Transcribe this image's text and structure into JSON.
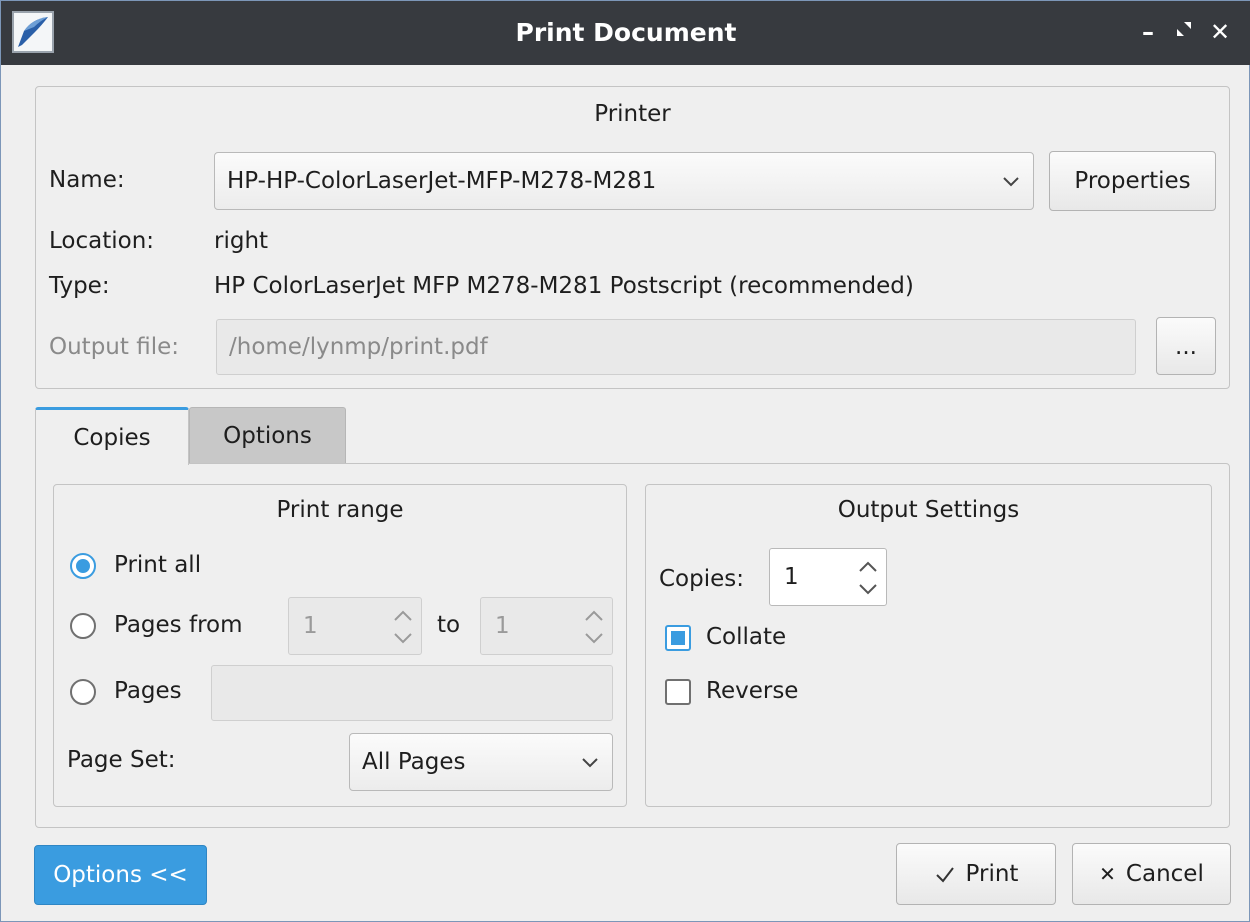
{
  "window": {
    "title": "Print Document"
  },
  "printer_group": {
    "title": "Printer",
    "name_label": "Name:",
    "printer_name": "HP-HP-ColorLaserJet-MFP-M278-M281",
    "properties_label": "Properties",
    "location_label": "Location:",
    "location_value": "right",
    "type_label": "Type:",
    "type_value": "HP ColorLaserJet MFP M278-M281 Postscript (recommended)",
    "output_file_label": "Output file:",
    "output_file_value": "/home/lynmp/print.pdf",
    "browse_label": "..."
  },
  "tabs": [
    {
      "label": "Copies",
      "active": true
    },
    {
      "label": "Options",
      "active": false
    }
  ],
  "print_range": {
    "title": "Print range",
    "print_all_label": "Print all",
    "pages_from_label": "Pages from",
    "from_value": "1",
    "to_label": "to",
    "to_value": "1",
    "pages_label": "Pages",
    "pages_value": "",
    "page_set_label": "Page Set:",
    "page_set_value": "All Pages",
    "selected": "Print all"
  },
  "output_settings": {
    "title": "Output Settings",
    "copies_label": "Copies:",
    "copies_value": "1",
    "collate_label": "Collate",
    "collate_checked": true,
    "reverse_label": "Reverse",
    "reverse_checked": false
  },
  "footer": {
    "options_toggle_label": "Options <<",
    "print_label": "Print",
    "cancel_label": "Cancel"
  },
  "colors": {
    "accent": "#3a9ce0",
    "titlebar": "#373a3f",
    "window_bg": "#efefef"
  }
}
